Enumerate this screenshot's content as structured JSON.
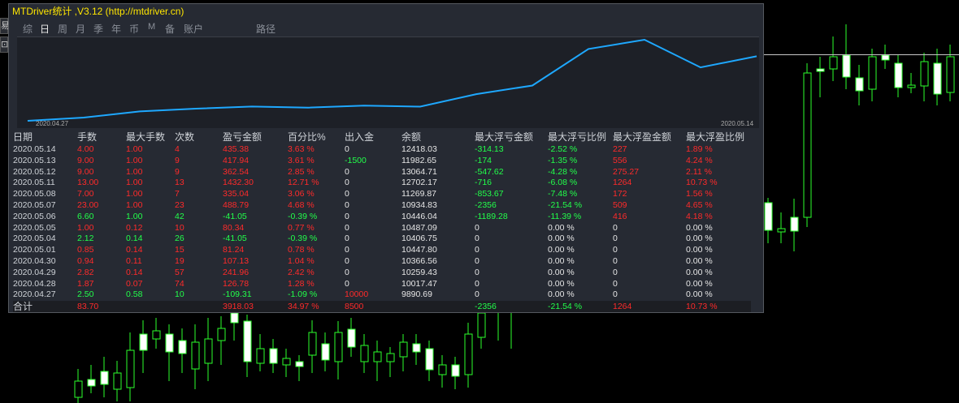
{
  "window": {
    "title": "MTDriver统计 ,V3.12 (http://mtdriver.cn)"
  },
  "tabs": [
    {
      "label": "综",
      "active": false
    },
    {
      "label": "日",
      "active": true
    },
    {
      "label": "周",
      "active": false
    },
    {
      "label": "月",
      "active": false
    },
    {
      "label": "季",
      "active": false
    },
    {
      "label": "年",
      "active": false
    },
    {
      "label": "币",
      "active": false
    },
    {
      "label": "M",
      "active": false
    },
    {
      "label": "备",
      "active": false
    },
    {
      "label": "账户",
      "active": false
    },
    {
      "label": "路径",
      "active": false
    }
  ],
  "equity_chart": {
    "start_label": "2020.04.27",
    "end_label": "2020.05.14",
    "line_color": "#1ea8ff"
  },
  "table": {
    "headers": [
      "日期",
      "手数",
      "最大手数",
      "次数",
      "盈亏金额",
      "百分比%",
      "出入金",
      "余额",
      "最大浮亏金额",
      "最大浮亏比例",
      "最大浮盈金额",
      "最大浮盈比例"
    ],
    "rows": [
      [
        "2020.05.14",
        "4.00",
        "1.00",
        "4",
        "435.38",
        "3.63 %",
        "0",
        "12418.03",
        "-314.13",
        "-2.52 %",
        "227",
        "1.89 %"
      ],
      [
        "2020.05.13",
        "9.00",
        "1.00",
        "9",
        "417.94",
        "3.61 %",
        "-1500",
        "11982.65",
        "-174",
        "-1.35 %",
        "556",
        "4.24 %"
      ],
      [
        "2020.05.12",
        "9.00",
        "1.00",
        "9",
        "362.54",
        "2.85 %",
        "0",
        "13064.71",
        "-547.62",
        "-4.28 %",
        "275.27",
        "2.11 %"
      ],
      [
        "2020.05.11",
        "13.00",
        "1.00",
        "13",
        "1432.30",
        "12.71 %",
        "0",
        "12702.17",
        "-716",
        "-6.08 %",
        "1264",
        "10.73 %"
      ],
      [
        "2020.05.08",
        "7.00",
        "1.00",
        "7",
        "335.04",
        "3.06 %",
        "0",
        "11269.87",
        "-853.67",
        "-7.48 %",
        "172",
        "1.56 %"
      ],
      [
        "2020.05.07",
        "23.00",
        "1.00",
        "23",
        "488.79",
        "4.68 %",
        "0",
        "10934.83",
        "-2356",
        "-21.54 %",
        "509",
        "4.65 %"
      ],
      [
        "2020.05.06",
        "6.60",
        "1.00",
        "42",
        "-41.05",
        "-0.39 %",
        "0",
        "10446.04",
        "-1189.28",
        "-11.39 %",
        "416",
        "4.18 %"
      ],
      [
        "2020.05.05",
        "1.00",
        "0.12",
        "10",
        "80.34",
        "0.77 %",
        "0",
        "10487.09",
        "0",
        "0.00 %",
        "0",
        "0.00 %"
      ],
      [
        "2020.05.04",
        "2.12",
        "0.14",
        "26",
        "-41.05",
        "-0.39 %",
        "0",
        "10406.75",
        "0",
        "0.00 %",
        "0",
        "0.00 %"
      ],
      [
        "2020.05.01",
        "0.85",
        "0.14",
        "15",
        "81.24",
        "0.78 %",
        "0",
        "10447.80",
        "0",
        "0.00 %",
        "0",
        "0.00 %"
      ],
      [
        "2020.04.30",
        "0.94",
        "0.11",
        "19",
        "107.13",
        "1.04 %",
        "0",
        "10366.56",
        "0",
        "0.00 %",
        "0",
        "0.00 %"
      ],
      [
        "2020.04.29",
        "2.82",
        "0.14",
        "57",
        "241.96",
        "2.42 %",
        "0",
        "10259.43",
        "0",
        "0.00 %",
        "0",
        "0.00 %"
      ],
      [
        "2020.04.28",
        "1.87",
        "0.07",
        "74",
        "126.78",
        "1.28 %",
        "0",
        "10017.47",
        "0",
        "0.00 %",
        "0",
        "0.00 %"
      ],
      [
        "2020.04.27",
        "2.50",
        "0.58",
        "10",
        "-109.31",
        "-1.09 %",
        "10000",
        "9890.69",
        "0",
        "0.00 %",
        "0",
        "0.00 %"
      ]
    ],
    "total": [
      "合计",
      "83.70",
      "",
      "",
      "3918.03",
      "34.97 %",
      "8500",
      "",
      "-2356",
      "-21.54 %",
      "1264",
      "10.73 %"
    ]
  },
  "colors": {
    "profit": "#ff2a2a",
    "loss": "#22ff4a",
    "neutral": "#e6e6e6",
    "title": "#ffe600"
  },
  "left_buttons": [
    "易",
    "⊡"
  ]
}
